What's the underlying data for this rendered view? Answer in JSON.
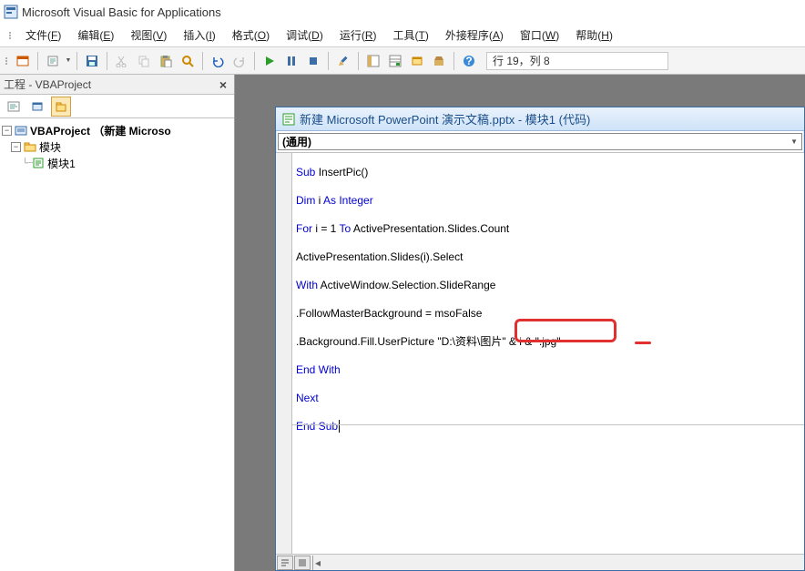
{
  "app_title": "Microsoft Visual Basic for Applications",
  "menubar": {
    "file": {
      "label": "文件",
      "accel": "F"
    },
    "edit": {
      "label": "编辑",
      "accel": "E"
    },
    "view": {
      "label": "视图",
      "accel": "V"
    },
    "insert": {
      "label": "插入",
      "accel": "I"
    },
    "format": {
      "label": "格式",
      "accel": "O"
    },
    "debug": {
      "label": "调试",
      "accel": "D"
    },
    "run": {
      "label": "运行",
      "accel": "R"
    },
    "tools": {
      "label": "工具",
      "accel": "T"
    },
    "addins": {
      "label": "外接程序",
      "accel": "A"
    },
    "window": {
      "label": "窗口",
      "accel": "W"
    },
    "help": {
      "label": "帮助",
      "accel": "H"
    }
  },
  "toolbar_status": "行 19，列 8",
  "project_panel": {
    "title": "工程 - VBAProject",
    "root": "VBAProject （新建 Microso",
    "folder": "模块",
    "module": "模块1"
  },
  "code_window": {
    "title": "新建 Microsoft PowerPoint 演示文稿.pptx - 模块1 (代码)",
    "combo_left": "(通用)",
    "lines": {
      "l1a": "Sub",
      "l1b": " InsertPic()",
      "l2a": "Dim",
      "l2b": " i ",
      "l2c": "As Integer",
      "l3a": "For",
      "l3b": " i = 1 ",
      "l3c": "To",
      "l3d": " ActivePresentation.Slides.Count",
      "l4": "ActivePresentation.Slides(i).Select",
      "l5a": "With",
      "l5b": " ActiveWindow.Selection.SlideRange",
      "l6": ".FollowMasterBackground = msoFalse",
      "l7a": ".Background.Fill.UserPicture ",
      "l7b": "\"D:\\资料\\图片\"",
      "l7c": " & i & \".jpg\"",
      "l8": "End With",
      "l9": "Next",
      "l10": "End Sub"
    }
  }
}
